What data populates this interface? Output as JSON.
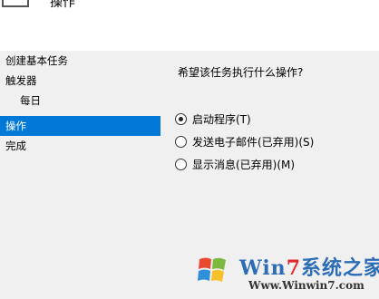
{
  "header": {
    "title": "操作",
    "icon": "task-icon"
  },
  "steps": [
    {
      "label": "创建基本任务",
      "sub": false,
      "active": false
    },
    {
      "label": "触发器",
      "sub": false,
      "active": false
    },
    {
      "label": "每日",
      "sub": true,
      "active": false
    },
    {
      "label": "操作",
      "sub": false,
      "active": true
    },
    {
      "label": "完成",
      "sub": false,
      "active": false
    }
  ],
  "main": {
    "question": "希望该任务执行什么操作?",
    "options": [
      {
        "label": "启动程序(T)",
        "checked": true
      },
      {
        "label": "发送电子邮件(已弃用)(S)",
        "checked": false
      },
      {
        "label": "显示消息(已弃用)(M)",
        "checked": false
      }
    ]
  },
  "watermark": {
    "brand_w": "Win",
    "brand_seven": "7",
    "brand_rest": "系统之家",
    "url": "Www.Winwin7.com"
  },
  "colors": {
    "selection": "#0078d7",
    "panel": "#f0f0f0"
  }
}
